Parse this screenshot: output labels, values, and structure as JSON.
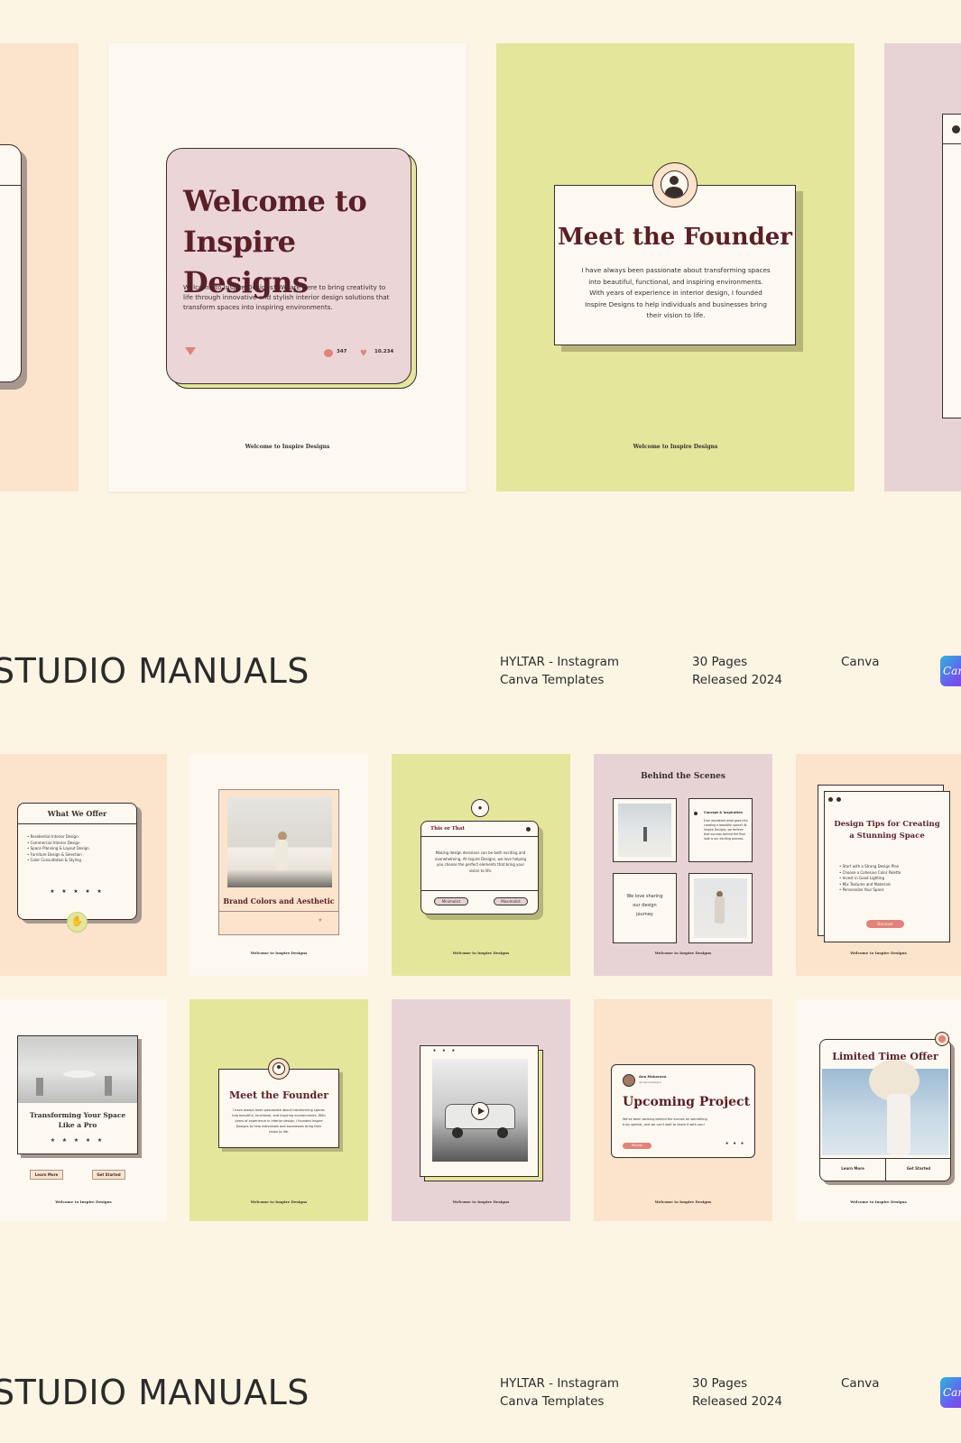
{
  "hero": {
    "welcome": {
      "title_line1": "Welcome to",
      "title_line2": "Inspire Designs",
      "body": "Welcome to Inspire Designs! We are here to bring creativity to life through innovative and stylish interior design solutions that transform spaces into inspiring environments.",
      "comments": "347",
      "likes": "10.234",
      "footer": "Welcome to Inspire Designs"
    },
    "founder": {
      "title": "Meet the Founder",
      "body": "I have always been passionate about transforming spaces into beautiful, functional, and inspiring environments. With years of experience in interior design, I founded Inspire Designs to help individuals and businesses bring their vision to life.",
      "footer": "Welcome to Inspire Designs"
    }
  },
  "info_bars": [
    {
      "brand": "STUDIO MANUALS",
      "product_line1": "HYLTAR - Instagram",
      "product_line2": "Canva Templates",
      "pages": "30 Pages",
      "released": "Released 2024",
      "platform": "Canva",
      "badge": "Canva"
    },
    {
      "brand": "STUDIO MANUALS",
      "product_line1": "HYLTAR - Instagram",
      "product_line2": "Canva Templates",
      "pages": "30 Pages",
      "released": "Released 2024",
      "platform": "Canva",
      "badge": "Canva"
    }
  ],
  "grid_row1": {
    "offer": {
      "title": "What We Offer",
      "items": [
        "Residential Interior Design",
        "Commercial Interior Design",
        "Space Planning & Layout Design",
        "Furniture Design & Selection",
        "Color Consultation & Styling"
      ],
      "stars": "★ ★ ★ ★ ★"
    },
    "brand_colors": {
      "title": "Brand Colors and Aesthetic",
      "footer": "Welcome to Inspire Designs"
    },
    "this_or_that": {
      "title": "This or That",
      "body": "Making design decisions can be both exciting and overwhelming. At Inspire Designs, we love helping you choose the perfect elements that bring your vision to life.",
      "option_a": "Minimalist",
      "option_b": "Maximalist",
      "footer": "Welcome to Inspire Designs"
    },
    "behind": {
      "title": "Behind the Scenes",
      "side_title": "Concept & Inspiration",
      "side_body": "Ever wondered what goes into creating a beautiful space? At Inspire Designs, we believe that success behind the final look is our exciting process.",
      "quote": "We love sharing our design journey",
      "footer": "Welcome to Inspire Designs"
    },
    "tips": {
      "title_line1": "Design Tips for Creating",
      "title_line2": "a Stunning Space",
      "items": [
        "Start with a Strong Design Plan",
        "Choose a Cohesive Color Palette",
        "Invest in Good Lighting",
        "Mix Textures and Materials",
        "Personalize Your Space"
      ],
      "button": "Discover",
      "footer": "Welcome to Inspire Designs"
    }
  },
  "grid_row2": {
    "transform": {
      "title_line1": "Transforming Your Space",
      "title_line2": "Like a Pro",
      "stars": "★ ★ ★ ★ ★",
      "btn_a": "Learn More",
      "btn_b": "Get Started",
      "footer": "Welcome to Inspire Designs"
    },
    "founder_small": {
      "title": "Meet the Founder",
      "body": "I have always been passionate about transforming spaces into beautiful, functional, and inspiring environments. With years of experience in interior design, I founded Inspire Designs to help individuals and businesses bring their vision to life.",
      "footer": "Welcome to Inspire Designs"
    },
    "video": {
      "footer": "Welcome to Inspire Designs"
    },
    "upcoming": {
      "author": "Ana Makarova",
      "author_sub": "@inspiredesigns",
      "title": "Upcoming Project",
      "body": "We've been working behind the scenes on something truly special, and we can't wait to share it with you!",
      "button": "Reveal",
      "footer": "Welcome to Inspire Designs"
    },
    "offer_limited": {
      "title": "Limited Time Offer",
      "btn_a": "Learn More",
      "btn_b": "Get Started",
      "footer": "Welcome to Inspire Designs"
    }
  },
  "colors": {
    "background": "#fdf5e4",
    "peach": "#fbe3cc",
    "cream": "#fdf9f1",
    "lime": "#e4e69c",
    "mauve": "#e7d3d6",
    "maroon": "#5a1f27",
    "coral": "#e0837a"
  }
}
